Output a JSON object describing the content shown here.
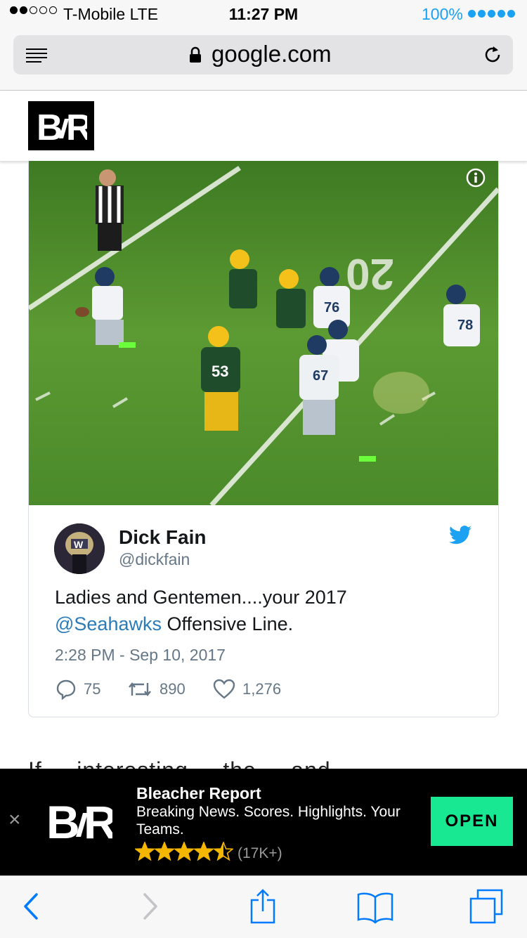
{
  "status_bar": {
    "carrier": "T-Mobile  LTE",
    "time": "11:27 PM",
    "battery": "100%"
  },
  "address_bar": {
    "url": "google.com",
    "icons": [
      "reader-icon",
      "lock-icon",
      "reload-icon"
    ]
  },
  "site": {
    "logo_text": "B/R"
  },
  "tweet": {
    "author_name": "Dick Fain",
    "author_handle": "@dickfain",
    "text_line1": "Ladies and Gentemen....your 2017",
    "mention": "@Seahawks",
    "text_line2_rest": " Offensive Line.",
    "timestamp": "2:28 PM - Sep 10, 2017",
    "replies": "75",
    "retweets": "890",
    "likes": "1,276",
    "media_description_icon": "info-icon"
  },
  "article": {
    "partial_text": "If ... interesting ... the ... and ..."
  },
  "app_banner": {
    "close": "×",
    "logo_text": "B/R",
    "title": "Bleacher Report",
    "description_line1": "Breaking News. Scores. Highlights. Your",
    "description_line2": "Teams.",
    "rating": 4.5,
    "rating_count": "(17K+)",
    "open_label": "OPEN"
  },
  "toolbar": {
    "icons": [
      "back-icon",
      "forward-icon",
      "share-icon",
      "bookmarks-icon",
      "tabs-icon"
    ]
  },
  "colors": {
    "accent_blue": "#007aff",
    "twitter_blue": "#1da1f2",
    "mention_blue": "#2b7bb9",
    "open_button_green": "#17e891",
    "star_gold": "#f5b600",
    "field_green": "#4f8d2a"
  }
}
